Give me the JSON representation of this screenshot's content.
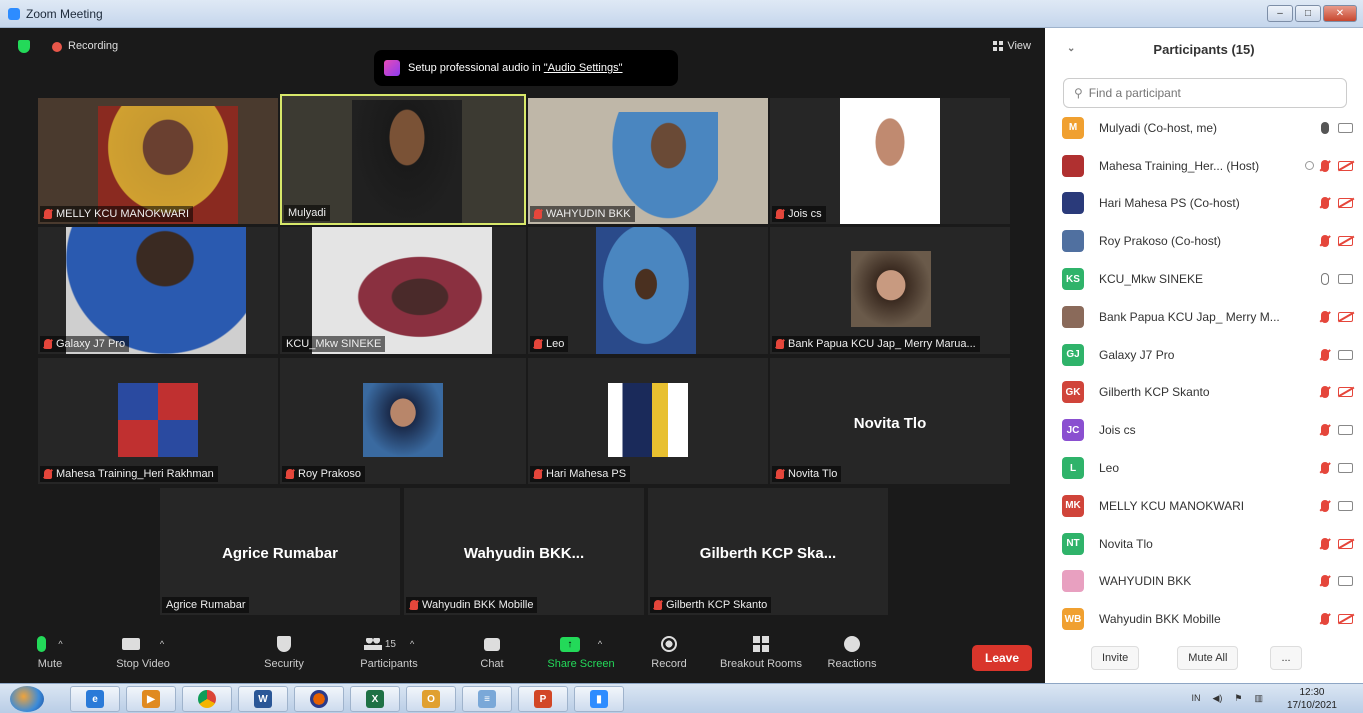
{
  "window": {
    "title": "Zoom Meeting"
  },
  "topbar": {
    "recording_label": "Recording",
    "view_label": "View",
    "toast_prefix": "Setup professional audio in ",
    "toast_link": "\"Audio Settings\""
  },
  "tiles": [
    {
      "name": "MELLY  KCU MANOKWARI"
    },
    {
      "name": "Mulyadi"
    },
    {
      "name": "WAHYUDIN BKK"
    },
    {
      "name": "Jois cs"
    },
    {
      "name": "Galaxy J7 Pro"
    },
    {
      "name": "KCU_Mkw SINEKE"
    },
    {
      "name": "Leo"
    },
    {
      "name": "Bank Papua KCU Jap_ Merry Marua..."
    },
    {
      "name": "Mahesa Training_Heri Rakhman"
    },
    {
      "name": "Roy Prakoso"
    },
    {
      "name": "Hari Mahesa PS"
    },
    {
      "name": "Novita Tlo",
      "center": "Novita Tlo"
    },
    {
      "name": "Agrice Rumabar",
      "center": "Agrice Rumabar"
    },
    {
      "name": "Wahyudin BKK Mobille",
      "center": "Wahyudin  BKK..."
    },
    {
      "name": "Gilberth KCP Skanto",
      "center": "Gilberth KCP Ska..."
    }
  ],
  "toolbar": {
    "mute": "Mute",
    "stop_video": "Stop Video",
    "security": "Security",
    "participants": "Participants",
    "participants_count": "15",
    "chat": "Chat",
    "share_screen": "Share Screen",
    "record": "Record",
    "breakout": "Breakout Rooms",
    "reactions": "Reactions",
    "leave": "Leave"
  },
  "panel": {
    "title": "Participants (15)",
    "search_placeholder": "Find a participant",
    "invite": "Invite",
    "mute_all": "Mute All",
    "more": "..."
  },
  "participants": [
    {
      "initials": "M",
      "name": "Mulyadi (Co-host, me)",
      "color": "#f0a030",
      "mic": "on",
      "cam": "on"
    },
    {
      "initials": "",
      "name": "Mahesa Training_Her... (Host)",
      "color": "#b03030",
      "mic": "muted",
      "cam": "off",
      "rec": true
    },
    {
      "initials": "",
      "name": "Hari Mahesa PS (Co-host)",
      "color": "#2a3a7a",
      "mic": "muted",
      "cam": "off"
    },
    {
      "initials": "",
      "name": "Roy Prakoso (Co-host)",
      "color": "#5070a0",
      "mic": "muted",
      "cam": "off"
    },
    {
      "initials": "KS",
      "name": "KCU_Mkw SINEKE",
      "color": "#2fb36a",
      "mic": "outline",
      "cam": "on"
    },
    {
      "initials": "",
      "name": "Bank Papua KCU Jap_ Merry M...",
      "color": "#8a6a5a",
      "mic": "muted",
      "cam": "off"
    },
    {
      "initials": "GJ",
      "name": "Galaxy J7 Pro",
      "color": "#2fb36a",
      "mic": "muted",
      "cam": "on"
    },
    {
      "initials": "GK",
      "name": "Gilberth KCP Skanto",
      "color": "#d0443a",
      "mic": "muted",
      "cam": "off"
    },
    {
      "initials": "JC",
      "name": "Jois cs",
      "color": "#8a4fd0",
      "mic": "muted",
      "cam": "on"
    },
    {
      "initials": "L",
      "name": "Leo",
      "color": "#2fb36a",
      "mic": "muted",
      "cam": "on"
    },
    {
      "initials": "MK",
      "name": "MELLY  KCU MANOKWARI",
      "color": "#d0443a",
      "mic": "muted",
      "cam": "on"
    },
    {
      "initials": "NT",
      "name": "Novita Tlo",
      "color": "#2fb36a",
      "mic": "muted",
      "cam": "off"
    },
    {
      "initials": "",
      "name": "WAHYUDIN BKK",
      "color": "#e8a0c0",
      "mic": "muted",
      "cam": "on"
    },
    {
      "initials": "WB",
      "name": "Wahyudin BKK Mobille",
      "color": "#f0a030",
      "mic": "muted",
      "cam": "off"
    }
  ],
  "taskbar": {
    "lang": "IN",
    "time": "12:30",
    "date": "17/10/2021"
  }
}
